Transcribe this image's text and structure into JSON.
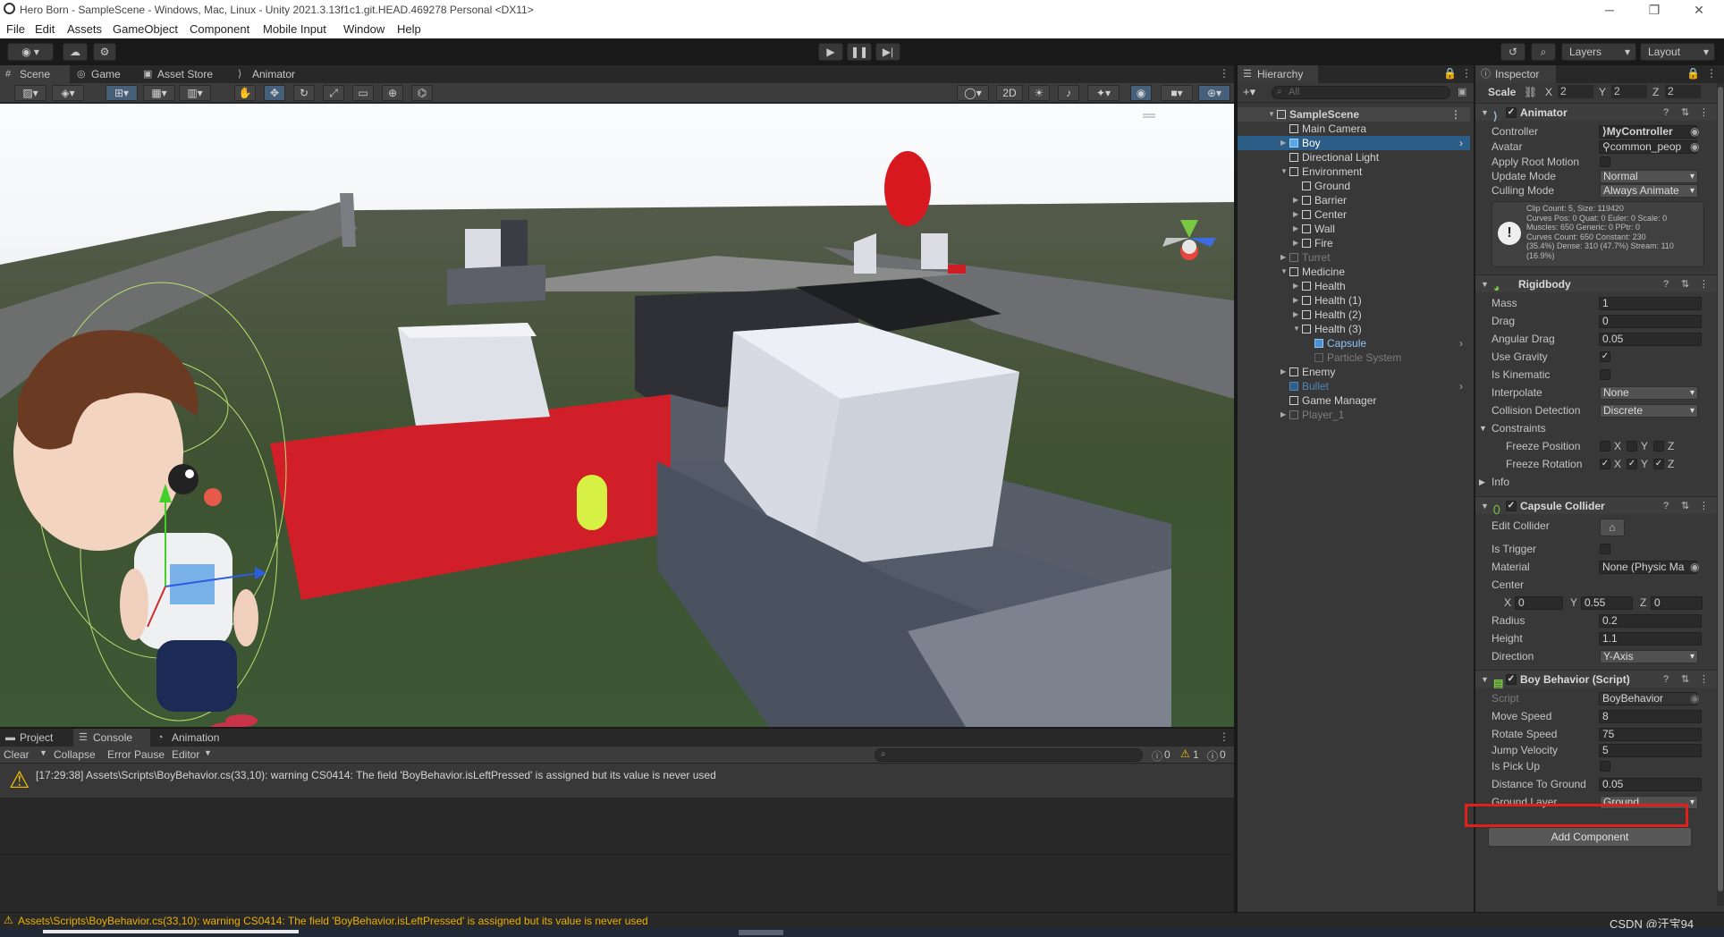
{
  "window": {
    "title": "Hero Born - SampleScene - Windows, Mac, Linux - Unity 2021.3.13f1c1.git.HEAD.469278 Personal <DX11>"
  },
  "menu": [
    "File",
    "Edit",
    "Assets",
    "GameObject",
    "Component",
    "Mobile Input",
    "Window",
    "Help"
  ],
  "toolbar": {
    "layers_label": "Layers",
    "layout_label": "Layout"
  },
  "scene_tabs": [
    "Scene",
    "Game",
    "Asset Store",
    "Animator"
  ],
  "scene_toolbar": {
    "mode_2d": "2D"
  },
  "hierarchy": {
    "tab": "Hierarchy",
    "search_placeholder": "All",
    "items": [
      {
        "label": "SampleScene"
      },
      {
        "label": "Main Camera"
      },
      {
        "label": "Boy"
      },
      {
        "label": "Directional Light"
      },
      {
        "label": "Environment"
      },
      {
        "label": "Ground"
      },
      {
        "label": "Barrier"
      },
      {
        "label": "Center"
      },
      {
        "label": "Wall"
      },
      {
        "label": "Fire"
      },
      {
        "label": "Turret"
      },
      {
        "label": "Medicine"
      },
      {
        "label": "Health"
      },
      {
        "label": "Health (1)"
      },
      {
        "label": "Health (2)"
      },
      {
        "label": "Health (3)"
      },
      {
        "label": "Capsule"
      },
      {
        "label": "Particle System"
      },
      {
        "label": "Enemy"
      },
      {
        "label": "Bullet"
      },
      {
        "label": "Game Manager"
      },
      {
        "label": "Player_1"
      }
    ]
  },
  "inspector": {
    "tab": "Inspector",
    "scale_label": "Scale",
    "scale": {
      "x_label": "X",
      "x": "2",
      "y_label": "Y",
      "y": "2",
      "z_label": "Z",
      "z": "2"
    },
    "animator": {
      "title": "Animator",
      "controller_label": "Controller",
      "controller": "MyController",
      "avatar_label": "Avatar",
      "avatar": "common_peop",
      "apply_root_label": "Apply Root Motion",
      "update_mode_label": "Update Mode",
      "update_mode": "Normal",
      "culling_label": "Culling Mode",
      "culling": "Always Animate",
      "info": "Clip Count: 5, Size: 119420\nCurves Pos: 0 Quat: 0 Euler: 0 Scale: 0\nMuscles: 650 Generic: 0 PPtr: 0\nCurves Count: 650 Constant: 230\n(35.4%) Dense: 310 (47.7%) Stream: 110\n(16.9%)"
    },
    "rigidbody": {
      "title": "Rigidbody",
      "mass_label": "Mass",
      "mass": "1",
      "drag_label": "Drag",
      "drag": "0",
      "angular_label": "Angular Drag",
      "angular": "0.05",
      "gravity_label": "Use Gravity",
      "kinematic_label": "Is Kinematic",
      "interp_label": "Interpolate",
      "interp": "None",
      "collision_label": "Collision Detection",
      "collision": "Discrete",
      "constraints_label": "Constraints",
      "freeze_pos_label": "Freeze Position",
      "freeze_rot_label": "Freeze Rotation",
      "x": "X",
      "y": "Y",
      "z": "Z",
      "info_label": "Info"
    },
    "capsule": {
      "title": "Capsule Collider",
      "edit_label": "Edit Collider",
      "trigger_label": "Is Trigger",
      "material_label": "Material",
      "material": "None (Physic Ma",
      "center_label": "Center",
      "cx": "0",
      "cy": "0.55",
      "cz": "0",
      "radius_label": "Radius",
      "radius": "0.2",
      "height_label": "Height",
      "height": "1.1",
      "direction_label": "Direction",
      "direction": "Y-Axis"
    },
    "script": {
      "title": "Boy Behavior (Script)",
      "script_label": "Script",
      "script": "BoyBehavior",
      "move_label": "Move Speed",
      "move": "8",
      "rotate_label": "Rotate Speed",
      "rotate": "75",
      "jump_label": "Jump Velocity",
      "jump": "5",
      "pickup_label": "Is Pick Up",
      "dist_label": "Distance To Ground",
      "dist": "0.05",
      "ground_label": "Ground Layer",
      "ground": "Ground"
    },
    "add_component": "Add Component"
  },
  "bottom": {
    "tabs": [
      "Project",
      "Console",
      "Animation"
    ],
    "clear": "Clear",
    "collapse": "Collapse",
    "error_pause": "Error Pause",
    "editor": "Editor",
    "counts": {
      "log": "0",
      "warn": "1",
      "error": "0"
    },
    "message": "[17:29:38] Assets\\Scripts\\BoyBehavior.cs(33,10): warning CS0414: The field 'BoyBehavior.isLeftPressed' is assigned but its value is never used"
  },
  "status": {
    "message": "Assets\\Scripts\\BoyBehavior.cs(33,10): warning CS0414: The field 'BoyBehavior.isLeftPressed' is assigned but its value is never used",
    "watermark": "CSDN @汗宝94"
  },
  "colors": {
    "selection": "#2c5d87",
    "highlight_box": "#e0201c",
    "warning": "#f0c000"
  }
}
